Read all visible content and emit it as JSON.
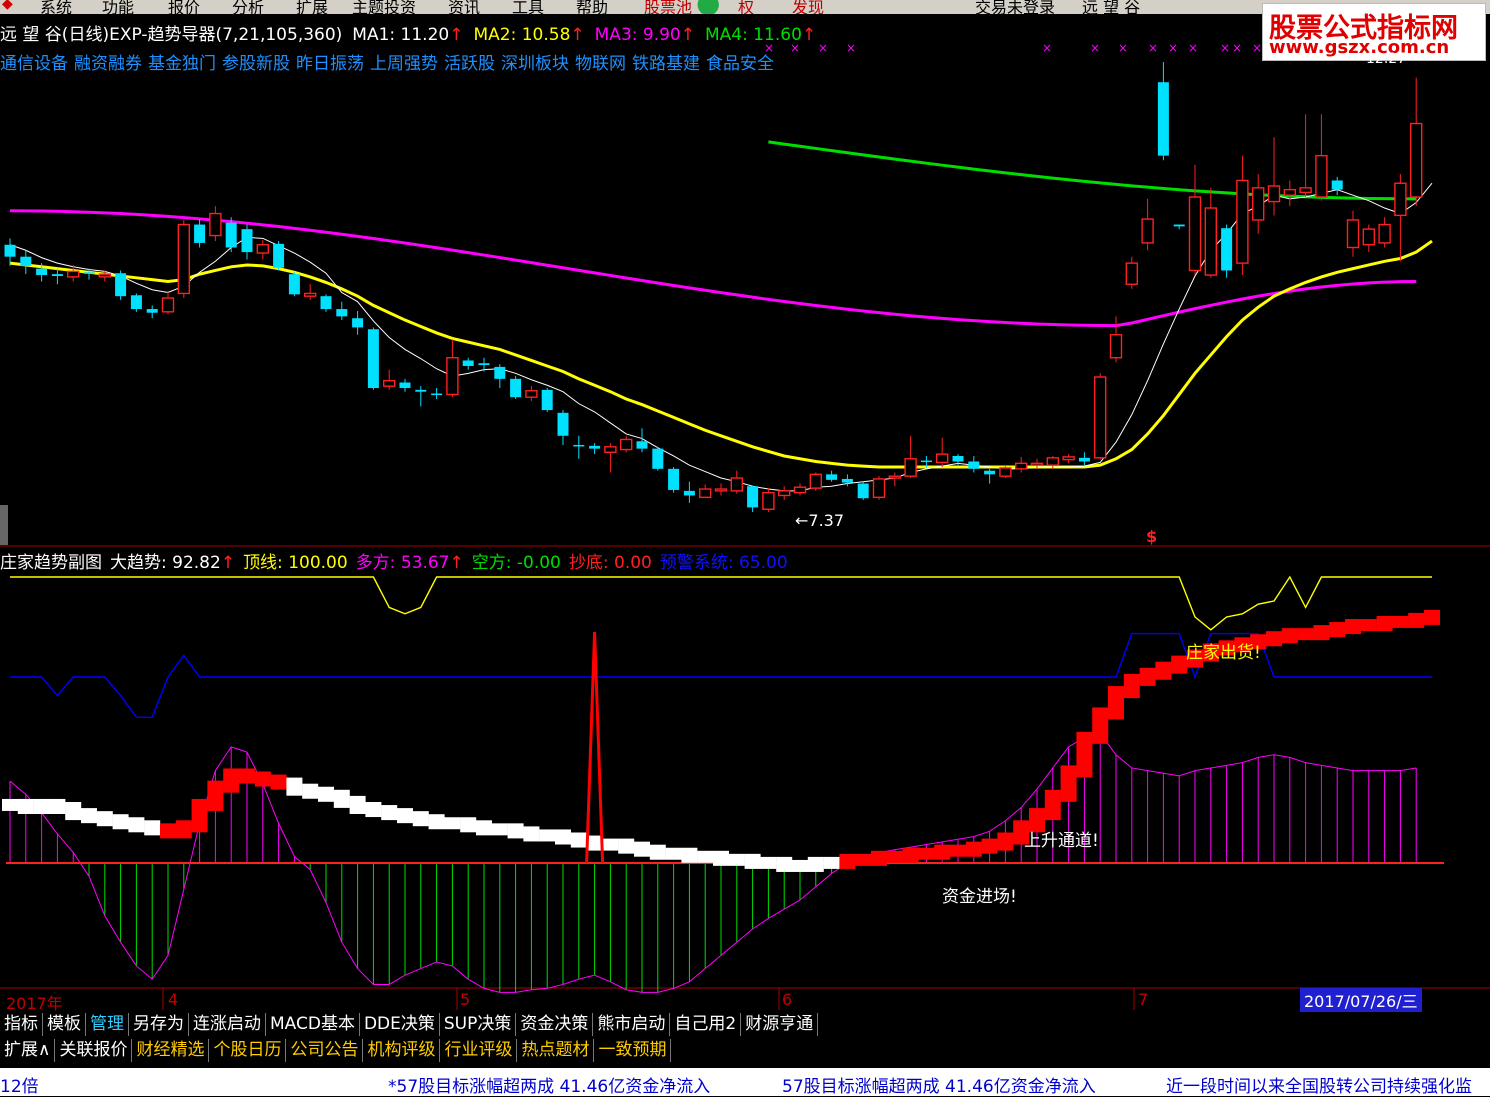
{
  "menu": {
    "items": [
      "系统",
      "功能",
      "报价",
      "分析",
      "扩展",
      "主题投资",
      "资讯",
      "工具",
      "帮助",
      "股票池",
      "权",
      "发现",
      "交易未登录",
      "远 望 谷"
    ]
  },
  "main_header": {
    "stock": "远 望 谷(日线)",
    "indicator": "EXP-趋势导器(7,21,105,360)",
    "ma1": "MA1: 11.20",
    "ma2": "MA2: 10.58",
    "ma3": "MA3: 9.90",
    "ma4": "MA4: 11.60"
  },
  "sectors": [
    "通信设备",
    "融资融券",
    "基金独门",
    "参股新股",
    "昨日振荡",
    "上周强势",
    "活跃股",
    "深圳板块",
    "物联网",
    "铁路基建",
    "食品安全"
  ],
  "logo": {
    "line1": "股票公式指标网",
    "line2": "www.gszx.com.cn"
  },
  "main_labels": {
    "low": "←7.37",
    "high": "12.27",
    "signal": "$"
  },
  "sub_header": {
    "name": "庄家趋势副图",
    "trend": "大趋势: 92.82",
    "top_line": "顶线: 100.00",
    "long": "多方: 53.67",
    "short": "空方: -0.00",
    "bottom": "抄底: 0.00",
    "warning": "预警系统: 65.00"
  },
  "sub_labels": {
    "dealer_out": "庄家出货!",
    "channel": "上升通道!",
    "capital": "资金进场!"
  },
  "dates": {
    "year": "2017年",
    "m4": "4",
    "m5": "5",
    "m6": "6",
    "m7": "7",
    "current": "2017/07/26/三"
  },
  "tabs_row1": [
    "指标",
    "模板",
    "管理",
    "另存为",
    "连涨启动",
    "MACD基本",
    "DDE决策",
    "SUP决策",
    "资金决策",
    "熊市启动",
    "自己用2",
    "财源亨通"
  ],
  "tabs_row2": [
    "扩展∧",
    "关联报价",
    "财经精选",
    "个股日历",
    "公司公告",
    "机构评级",
    "行业评级",
    "热点题材",
    "一致预期"
  ],
  "ticker": {
    "left": "12倍",
    "news1": "*57股目标涨幅超两成 41.46亿资金净流入",
    "news2": "57股目标涨幅超两成 41.46亿资金净流入",
    "news3": "近一段时间以来全国股转公司持续强化监"
  },
  "colors": {
    "up": "#ff2020",
    "down": "#00e0ff",
    "ma7": "#ffffff",
    "ma21": "#ffff00",
    "ma105": "#ff00ff",
    "ma360": "#00dd00",
    "sub_top": "#ffff00",
    "sub_warn": "#0000ff"
  },
  "chart_data": {
    "type": "candlestick",
    "price_low": 7.37,
    "price_high": 12.27,
    "candles": [
      {
        "o": 10.28,
        "c": 10.15,
        "h": 10.35,
        "l": 10.05
      },
      {
        "o": 10.15,
        "c": 10.05,
        "h": 10.22,
        "l": 9.96
      },
      {
        "o": 10.02,
        "c": 9.95,
        "h": 10.08,
        "l": 9.88
      },
      {
        "o": 9.96,
        "c": 9.94,
        "h": 10.02,
        "l": 9.85
      },
      {
        "o": 9.93,
        "c": 9.99,
        "h": 10.06,
        "l": 9.88
      },
      {
        "o": 9.98,
        "c": 9.97,
        "h": 10.02,
        "l": 9.9
      },
      {
        "o": 9.93,
        "c": 9.96,
        "h": 10.0,
        "l": 9.88
      },
      {
        "o": 9.97,
        "c": 9.72,
        "h": 10.0,
        "l": 9.68
      },
      {
        "o": 9.73,
        "c": 9.58,
        "h": 9.75,
        "l": 9.55
      },
      {
        "o": 9.58,
        "c": 9.54,
        "h": 9.62,
        "l": 9.48
      },
      {
        "o": 9.55,
        "c": 9.7,
        "h": 9.78,
        "l": 9.52
      },
      {
        "o": 9.75,
        "c": 10.5,
        "h": 10.55,
        "l": 9.7
      },
      {
        "o": 10.5,
        "c": 10.3,
        "h": 10.56,
        "l": 10.25
      },
      {
        "o": 10.38,
        "c": 10.62,
        "h": 10.7,
        "l": 10.32
      },
      {
        "o": 10.52,
        "c": 10.25,
        "h": 10.58,
        "l": 10.2
      },
      {
        "o": 10.45,
        "c": 10.2,
        "h": 10.5,
        "l": 10.12
      },
      {
        "o": 10.19,
        "c": 10.28,
        "h": 10.33,
        "l": 10.12
      },
      {
        "o": 10.29,
        "c": 10.03,
        "h": 10.32,
        "l": 10.0
      },
      {
        "o": 9.96,
        "c": 9.74,
        "h": 9.98,
        "l": 9.72
      },
      {
        "o": 9.72,
        "c": 9.75,
        "h": 9.85,
        "l": 9.68
      },
      {
        "o": 9.72,
        "c": 9.58,
        "h": 9.74,
        "l": 9.55
      },
      {
        "o": 9.58,
        "c": 9.5,
        "h": 9.66,
        "l": 9.46
      },
      {
        "o": 9.48,
        "c": 9.38,
        "h": 9.56,
        "l": 9.3
      },
      {
        "o": 9.36,
        "c": 8.72,
        "h": 9.38,
        "l": 8.7
      },
      {
        "o": 8.74,
        "c": 8.8,
        "h": 8.92,
        "l": 8.7
      },
      {
        "o": 8.78,
        "c": 8.72,
        "h": 8.82,
        "l": 8.68
      },
      {
        "o": 8.7,
        "c": 8.68,
        "h": 8.74,
        "l": 8.52
      },
      {
        "o": 8.66,
        "c": 8.65,
        "h": 8.72,
        "l": 8.6
      },
      {
        "o": 8.65,
        "c": 9.05,
        "h": 9.25,
        "l": 8.62
      },
      {
        "o": 9.02,
        "c": 8.96,
        "h": 9.05,
        "l": 8.92
      },
      {
        "o": 8.99,
        "c": 8.97,
        "h": 9.05,
        "l": 8.9
      },
      {
        "o": 8.95,
        "c": 8.82,
        "h": 8.98,
        "l": 8.72
      },
      {
        "o": 8.82,
        "c": 8.62,
        "h": 8.85,
        "l": 8.6
      },
      {
        "o": 8.62,
        "c": 8.69,
        "h": 8.74,
        "l": 8.58
      },
      {
        "o": 8.7,
        "c": 8.48,
        "h": 8.72,
        "l": 8.46
      },
      {
        "o": 8.45,
        "c": 8.2,
        "h": 8.48,
        "l": 8.1
      },
      {
        "o": 8.1,
        "c": 8.09,
        "h": 8.2,
        "l": 7.95
      },
      {
        "o": 8.09,
        "c": 8.06,
        "h": 8.12,
        "l": 8.0
      },
      {
        "o": 8.02,
        "c": 8.08,
        "h": 8.12,
        "l": 7.8
      },
      {
        "o": 8.05,
        "c": 8.16,
        "h": 8.2,
        "l": 8.02
      },
      {
        "o": 8.14,
        "c": 8.06,
        "h": 8.28,
        "l": 8.02
      },
      {
        "o": 8.06,
        "c": 7.84,
        "h": 8.08,
        "l": 7.82
      },
      {
        "o": 7.84,
        "c": 7.61,
        "h": 7.86,
        "l": 7.58
      },
      {
        "o": 7.6,
        "c": 7.55,
        "h": 7.7,
        "l": 7.47
      },
      {
        "o": 7.53,
        "c": 7.62,
        "h": 7.67,
        "l": 7.52
      },
      {
        "o": 7.6,
        "c": 7.62,
        "h": 7.68,
        "l": 7.55
      },
      {
        "o": 7.6,
        "c": 7.74,
        "h": 7.82,
        "l": 7.57
      },
      {
        "o": 7.65,
        "c": 7.42,
        "h": 7.66,
        "l": 7.37
      },
      {
        "o": 7.4,
        "c": 7.58,
        "h": 7.63,
        "l": 7.37
      },
      {
        "o": 7.55,
        "c": 7.6,
        "h": 7.65,
        "l": 7.5
      },
      {
        "o": 7.58,
        "c": 7.64,
        "h": 7.68,
        "l": 7.55
      },
      {
        "o": 7.63,
        "c": 7.78,
        "h": 7.8,
        "l": 7.6
      },
      {
        "o": 7.78,
        "c": 7.72,
        "h": 7.82,
        "l": 7.7
      },
      {
        "o": 7.73,
        "c": 7.69,
        "h": 7.78,
        "l": 7.65
      },
      {
        "o": 7.68,
        "c": 7.52,
        "h": 7.7,
        "l": 7.5
      },
      {
        "o": 7.53,
        "c": 7.73,
        "h": 7.76,
        "l": 7.5
      },
      {
        "o": 7.74,
        "c": 7.76,
        "h": 7.8,
        "l": 7.65
      },
      {
        "o": 7.76,
        "c": 7.95,
        "h": 8.2,
        "l": 7.74
      },
      {
        "o": 7.93,
        "c": 7.92,
        "h": 7.98,
        "l": 7.85
      },
      {
        "o": 7.91,
        "c": 8.0,
        "h": 8.18,
        "l": 7.86
      },
      {
        "o": 7.98,
        "c": 7.92,
        "h": 8.0,
        "l": 7.88
      },
      {
        "o": 7.92,
        "c": 7.84,
        "h": 7.98,
        "l": 7.8
      },
      {
        "o": 7.82,
        "c": 7.78,
        "h": 7.84,
        "l": 7.68
      },
      {
        "o": 7.76,
        "c": 7.85,
        "h": 7.87,
        "l": 7.74
      },
      {
        "o": 7.84,
        "c": 7.9,
        "h": 7.97,
        "l": 7.8
      },
      {
        "o": 7.88,
        "c": 7.9,
        "h": 7.95,
        "l": 7.84
      },
      {
        "o": 7.88,
        "c": 7.96,
        "h": 7.98,
        "l": 7.84
      },
      {
        "o": 7.94,
        "c": 7.97,
        "h": 8.0,
        "l": 7.9
      },
      {
        "o": 7.96,
        "c": 7.92,
        "h": 8.02,
        "l": 7.88
      },
      {
        "o": 7.96,
        "c": 8.84,
        "h": 8.88,
        "l": 7.94
      },
      {
        "o": 9.05,
        "c": 9.3,
        "h": 9.5,
        "l": 9.0
      },
      {
        "o": 9.85,
        "c": 10.08,
        "h": 10.15,
        "l": 9.8
      },
      {
        "o": 10.3,
        "c": 10.56,
        "h": 10.78,
        "l": 10.22
      },
      {
        "o": 12.05,
        "c": 11.25,
        "h": 12.27,
        "l": 11.2
      },
      {
        "o": 10.5,
        "c": 10.48,
        "h": 10.5,
        "l": 10.45
      },
      {
        "o": 10.0,
        "c": 10.8,
        "h": 11.15,
        "l": 9.95
      },
      {
        "o": 9.95,
        "c": 10.68,
        "h": 10.9,
        "l": 9.92
      },
      {
        "o": 10.46,
        "c": 10.0,
        "h": 10.5,
        "l": 9.92
      },
      {
        "o": 10.08,
        "c": 10.98,
        "h": 11.25,
        "l": 9.95
      },
      {
        "o": 10.55,
        "c": 10.9,
        "h": 11.05,
        "l": 10.4
      },
      {
        "o": 10.75,
        "c": 10.92,
        "h": 11.45,
        "l": 10.6
      },
      {
        "o": 10.82,
        "c": 10.88,
        "h": 10.98,
        "l": 10.7
      },
      {
        "o": 10.85,
        "c": 10.9,
        "h": 11.7,
        "l": 10.8
      },
      {
        "o": 10.8,
        "c": 11.25,
        "h": 11.7,
        "l": 10.76
      },
      {
        "o": 10.98,
        "c": 10.88,
        "h": 11.02,
        "l": 10.82
      },
      {
        "o": 10.25,
        "c": 10.55,
        "h": 10.65,
        "l": 10.15
      },
      {
        "o": 10.28,
        "c": 10.45,
        "h": 10.5,
        "l": 10.2
      },
      {
        "o": 10.3,
        "c": 10.5,
        "h": 10.58,
        "l": 10.25
      },
      {
        "o": 10.6,
        "c": 10.95,
        "h": 11.05,
        "l": 10.1
      },
      {
        "o": 10.8,
        "c": 11.6,
        "h": 12.1,
        "l": 10.7
      }
    ],
    "ma7": [
      10.28,
      10.22,
      10.14,
      10.08,
      10.04,
      10.01,
      9.99,
      9.94,
      9.86,
      9.79,
      9.76,
      9.83,
      9.98,
      10.1,
      10.25,
      10.36,
      10.35,
      10.27,
      10.19,
      10.09,
      9.97,
      9.76,
      9.66,
      9.45,
      9.27,
      9.14,
      9.04,
      8.93,
      8.85,
      8.88,
      8.92,
      8.93,
      8.88,
      8.81,
      8.75,
      8.68,
      8.55,
      8.46,
      8.34,
      8.22,
      8.17,
      8.07,
      7.98,
      7.88,
      7.81,
      7.74,
      7.7,
      7.65,
      7.62,
      7.6,
      7.6,
      7.64,
      7.65,
      7.68,
      7.7,
      7.72,
      7.74,
      7.8,
      7.84,
      7.87,
      7.9,
      7.88,
      7.86,
      7.84,
      7.84,
      7.86,
      7.86,
      7.86,
      7.87,
      7.91,
      8.13,
      8.43,
      8.8,
      9.2,
      9.58,
      9.94,
      10.22,
      10.4,
      10.62,
      10.7,
      10.82,
      10.78,
      10.8,
      10.84,
      10.88,
      10.82,
      10.76,
      10.68,
      10.62,
      10.74,
      10.95
    ],
    "ma21": [
      10.08,
      10.06,
      10.04,
      10.02,
      10.0,
      9.98,
      9.96,
      9.94,
      9.92,
      9.9,
      9.88,
      9.9,
      9.96,
      10.0,
      10.04,
      10.06,
      10.05,
      10.02,
      9.98,
      9.93,
      9.87,
      9.8,
      9.72,
      9.62,
      9.54,
      9.46,
      9.39,
      9.32,
      9.26,
      9.22,
      9.18,
      9.14,
      9.08,
      9.02,
      8.96,
      8.9,
      8.82,
      8.75,
      8.68,
      8.6,
      8.54,
      8.47,
      8.4,
      8.33,
      8.26,
      8.2,
      8.14,
      8.08,
      8.03,
      7.98,
      7.95,
      7.92,
      7.9,
      7.88,
      7.87,
      7.86,
      7.86,
      7.86,
      7.86,
      7.86,
      7.86,
      7.86,
      7.86,
      7.86,
      7.86,
      7.86,
      7.86,
      7.86,
      7.86,
      7.88,
      7.95,
      8.05,
      8.22,
      8.42,
      8.65,
      8.88,
      9.08,
      9.28,
      9.46,
      9.6,
      9.72,
      9.8,
      9.87,
      9.93,
      9.98,
      10.02,
      10.06,
      10.1,
      10.13,
      10.2,
      10.32
    ],
    "ma105_start": 10.65,
    "ma105_min": 9.4,
    "ma105_end": 9.88,
    "ma360_start": 11.4,
    "ma360_end": 10.78,
    "sub_bars": [
      33,
      32,
      33,
      32,
      30,
      29,
      28,
      27,
      26,
      25,
      24,
      26,
      33,
      39,
      43,
      42,
      41,
      40,
      38,
      37,
      36,
      34,
      32,
      31,
      30,
      29,
      28,
      27,
      27,
      26,
      25,
      25,
      24,
      23,
      23,
      22,
      21,
      20,
      20,
      19,
      18,
      17,
      17,
      16,
      16,
      15,
      15,
      14,
      14,
      13,
      13,
      14,
      14,
      15,
      15,
      16,
      16,
      17,
      17,
      18,
      18,
      19,
      20,
      22,
      26,
      30,
      36,
      44,
      55,
      63,
      70,
      74,
      76,
      78,
      80,
      82,
      84,
      85,
      86,
      87,
      88,
      89,
      89,
      90,
      91,
      92,
      92,
      93,
      93,
      94,
      95
    ],
    "osc": [
      62,
      52,
      38,
      22,
      8,
      -10,
      -40,
      -60,
      -78,
      -88,
      -70,
      -20,
      30,
      70,
      88,
      84,
      60,
      30,
      5,
      -5,
      -30,
      -60,
      -80,
      -92,
      -92,
      -85,
      -80,
      -75,
      -78,
      -88,
      -95,
      -98,
      -98,
      -96,
      -95,
      -92,
      -88,
      -85,
      -90,
      -96,
      -98,
      -98,
      -95,
      -90,
      -80,
      -70,
      -60,
      -50,
      -42,
      -35,
      -28,
      -18,
      -8,
      0,
      4,
      8,
      10,
      12,
      14,
      16,
      18,
      20,
      24,
      32,
      42,
      56,
      72,
      88,
      95,
      98,
      82,
      72,
      70,
      68,
      66,
      70,
      72,
      74,
      76,
      80,
      82,
      80,
      76,
      74,
      72,
      70,
      70,
      70,
      70,
      72
    ],
    "top_line": [
      95,
      95,
      95,
      95,
      95,
      95,
      95,
      95,
      95,
      95,
      95,
      95,
      95,
      95,
      95,
      95,
      95,
      95,
      95,
      95,
      95,
      95,
      95,
      95,
      76,
      72,
      76,
      95,
      95,
      95,
      95,
      95,
      95,
      95,
      95,
      95,
      95,
      95,
      95,
      95,
      95,
      95,
      95,
      95,
      95,
      95,
      95,
      95,
      95,
      95,
      95,
      95,
      95,
      95,
      95,
      95,
      95,
      95,
      95,
      95,
      95,
      95,
      95,
      95,
      95,
      95,
      95,
      95,
      95,
      95,
      95,
      95,
      95,
      95,
      95,
      70,
      62,
      70,
      72,
      78,
      80,
      95,
      76,
      95,
      95,
      95,
      95,
      95,
      95,
      95,
      95
    ],
    "warn_line": [
      68,
      68,
      68,
      62,
      68,
      68,
      68,
      62,
      55,
      55,
      68,
      75,
      68,
      68,
      68,
      68,
      68,
      68,
      68,
      68,
      68,
      68,
      68,
      68,
      68,
      68,
      68,
      68,
      68,
      68,
      68,
      68,
      68,
      68,
      68,
      68,
      68,
      68,
      68,
      68,
      68,
      68,
      68,
      68,
      68,
      68,
      68,
      68,
      68,
      68,
      68,
      68,
      68,
      68,
      68,
      68,
      68,
      68,
      68,
      68,
      68,
      68,
      68,
      68,
      68,
      68,
      68,
      68,
      68,
      68,
      68,
      82,
      82,
      82,
      82,
      68,
      82,
      82,
      82,
      82,
      68,
      68,
      68,
      68,
      68,
      68,
      68,
      68,
      68,
      68,
      68
    ],
    "spike": {
      "index": 37,
      "value": 100
    }
  }
}
